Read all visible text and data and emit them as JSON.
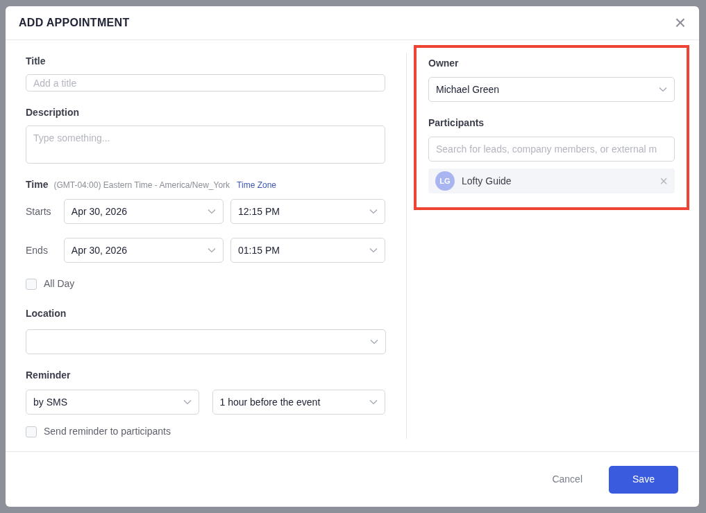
{
  "dialog": {
    "title": "ADD APPOINTMENT",
    "close": "×",
    "title_field": {
      "label": "Title",
      "placeholder": "Add a title"
    },
    "description": {
      "label": "Description",
      "placeholder": "Type something..."
    },
    "time": {
      "label": "Time",
      "timezone": "(GMT-04:00) Eastern Time - America/New_York",
      "timezone_link": "Time Zone",
      "rows": [
        {
          "label": "Starts",
          "date": "Apr 30, 2026",
          "time": "12:15 PM"
        },
        {
          "label": "Ends",
          "date": "Apr 30, 2026",
          "time": "01:15 PM"
        }
      ],
      "all_day": {
        "label": "All Day",
        "checked": false
      }
    },
    "location": {
      "label": "Location"
    },
    "reminder": {
      "label": "Reminder",
      "method": "by SMS",
      "when": "1 hour before the event",
      "send_to_participants": {
        "label": "Send reminder to participants",
        "checked": false
      }
    },
    "owner": {
      "label": "Owner",
      "value": "Michael Green"
    },
    "participants": {
      "label": "Participants",
      "placeholder": "Search for leads, company members, or external m",
      "items": [
        {
          "initials": "LG",
          "name": "Lofty Guide",
          "remove": "×"
        }
      ]
    },
    "highlighted": true,
    "buttons": {
      "cancel": "Cancel",
      "save": "Save"
    }
  }
}
